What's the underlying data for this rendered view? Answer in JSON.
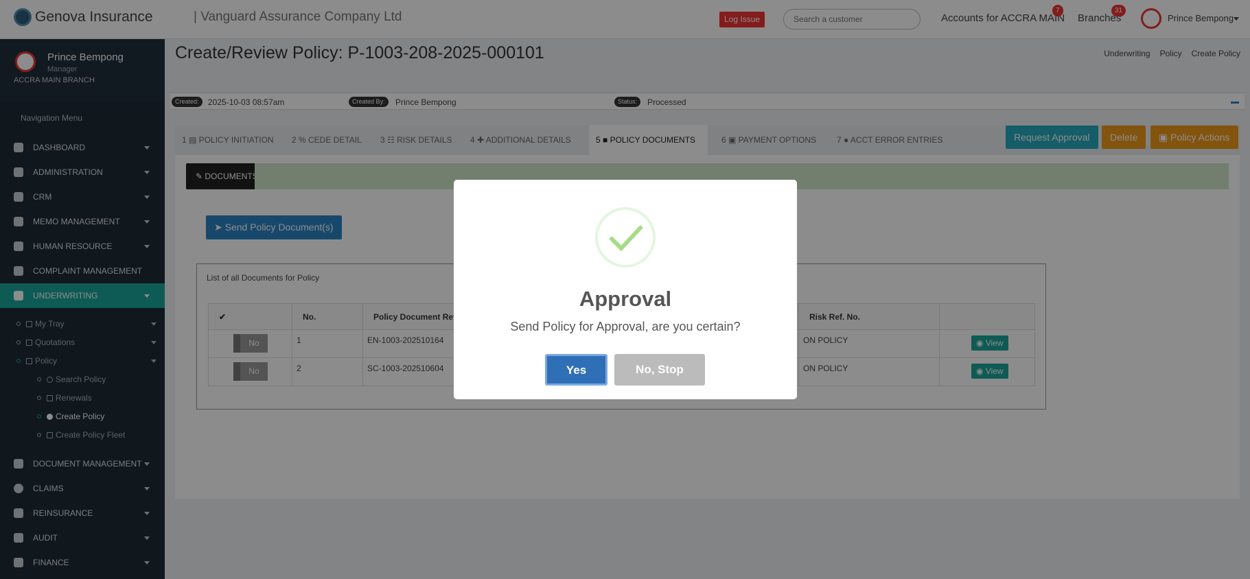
{
  "topbar": {
    "brand": "Genova Insurance",
    "company": "| Vanguard Assurance Company Ltd",
    "log_issue": "Log Issue",
    "search_placeholder": "Search a customer",
    "accounts_label": "Accounts for ACCRA MAIN",
    "accounts_badge": "7",
    "branches_label": "Branches",
    "branches_badge": "31",
    "user": "Prince Bempong"
  },
  "sidebar": {
    "profile": {
      "name": "Prince Bempong",
      "role": "Manager",
      "branch": "ACCRA MAIN BRANCH"
    },
    "nav_title": "Navigation Menu",
    "items": [
      {
        "label": "DASHBOARD",
        "icon": "dashboard-icon"
      },
      {
        "label": "ADMINISTRATION",
        "icon": "gear-icon"
      },
      {
        "label": "CRM",
        "icon": "user-icon"
      },
      {
        "label": "MEMO MANAGEMENT",
        "icon": "memo-icon"
      },
      {
        "label": "HUMAN RESOURCE",
        "icon": "users-icon"
      },
      {
        "label": "COMPLAINT MANAGEMENT",
        "icon": "alert-icon"
      },
      {
        "label": "UNDERWRITING",
        "icon": "list-icon"
      }
    ],
    "subitems": [
      {
        "label": "My Tray"
      },
      {
        "label": "Quotations"
      },
      {
        "label": "Policy"
      },
      {
        "label": "Search Policy"
      },
      {
        "label": "Renewals"
      },
      {
        "label": "Create Policy"
      },
      {
        "label": "Create Policy Fleet"
      }
    ],
    "items_after": [
      {
        "label": "DOCUMENT MANAGEMENT"
      },
      {
        "label": "CLAIMS"
      },
      {
        "label": "REINSURANCE"
      },
      {
        "label": "AUDIT"
      },
      {
        "label": "FINANCE"
      }
    ]
  },
  "main": {
    "title": "Create/Review Policy: P-1003-208-2025-000101",
    "breadcrumb": [
      "Underwriting",
      "Policy",
      "Create Policy"
    ],
    "info": {
      "created_label": "Created:",
      "created": "2025-10-03 08:57am",
      "created_by_label": "Created By:",
      "created_by": "Prince Bempong",
      "status_label": "Status:",
      "status": "Processed"
    },
    "tabs": [
      "1 ▤ POLICY INITIATION",
      "2 % CEDE DETAIL",
      "3 ☷ RISK DETAILS",
      "4 ✚ ADDITIONAL DETAILS",
      "5 ■ POLICY DOCUMENTS",
      "6 ▣ PAYMENT OPTIONS",
      "7 ● ACCT ERROR ENTRIES"
    ],
    "buttons": {
      "request_approval": "Request Approval",
      "delete": "Delete",
      "policy_actions": "▣ Policy Actions"
    },
    "documents_tab": "✎ DOCUMENTS",
    "send_button": "➤  Send Policy Document(s)",
    "list_title": "List of all Documents for Policy",
    "table": {
      "headers": [
        "✔",
        "No.",
        "Policy Document Ref",
        "",
        "Risk Ref. No.",
        ""
      ],
      "rows": [
        {
          "toggle": "No",
          "no": "1",
          "ref": "EN-1003-202510164",
          "risk": "ON POLICY",
          "view": "◉ View"
        },
        {
          "toggle": "No",
          "no": "2",
          "ref": "SC-1003-202510604",
          "risk": "ON POLICY",
          "view": "◉ View"
        }
      ]
    }
  },
  "modal": {
    "title": "Approval",
    "message": "Send Policy for Approval, are you certain?",
    "yes": "Yes",
    "no": "No, Stop"
  }
}
